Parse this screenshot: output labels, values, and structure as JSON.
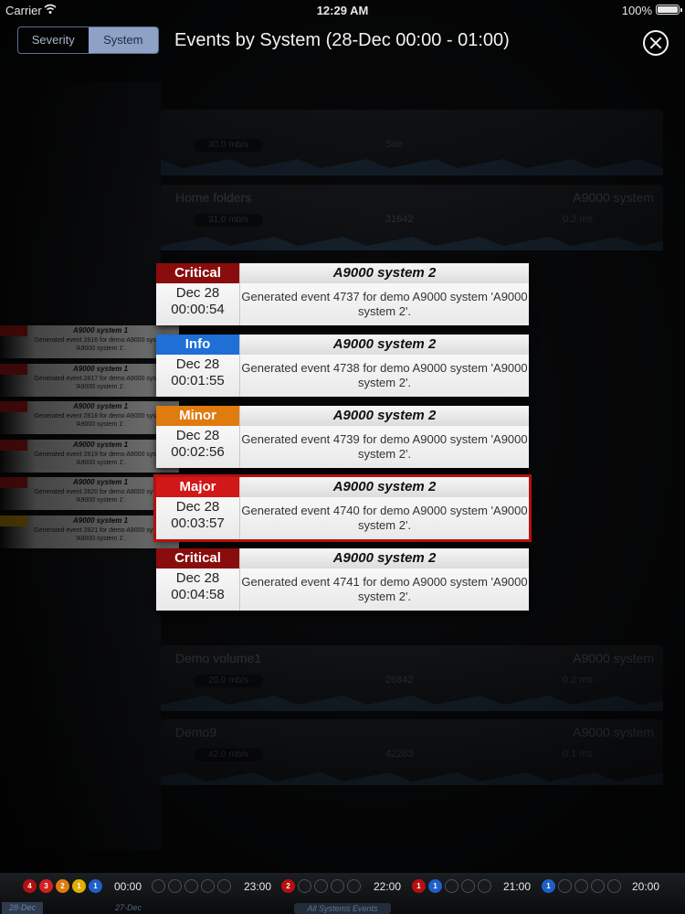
{
  "status_bar": {
    "carrier": "Carrier",
    "time": "12:29 AM",
    "battery": "100%"
  },
  "header": {
    "tabs": [
      {
        "label": "Severity",
        "active": false
      },
      {
        "label": "System",
        "active": true
      }
    ],
    "title": "Events by System (28-Dec 00:00 - 01:00)"
  },
  "background": {
    "panels": [
      {
        "name": "",
        "system": "",
        "pill": "30.0 mb/s",
        "mid": "Sim",
        "right": ""
      },
      {
        "name": "Home folders",
        "system": "A9000 system",
        "pill": "31.0 mb/s",
        "mid": "31642",
        "right": "0.2 ms"
      },
      {
        "name": "Demo volume1",
        "system": "A9000 system",
        "pill": "20.0 mb/s",
        "mid": "26842",
        "right": "0.2 ms"
      },
      {
        "name": "Demo9",
        "system": "A9000 system",
        "pill": "42.0 mb/s",
        "mid": "42263",
        "right": "0.1 ms"
      }
    ],
    "stack_events": [
      {
        "title": "A9000 system 1",
        "desc": "Generated event 2816 for demo A9000 system 'A9000 system 1'.",
        "color": "#c01818"
      },
      {
        "title": "A9000 system 1",
        "desc": "Generated event 2817 for demo A9000 system 'A9000 system 1'.",
        "color": "#c01818"
      },
      {
        "title": "A9000 system 1",
        "desc": "Generated event 2818 for demo A9000 system 'A9000 system 1'.",
        "color": "#c01818"
      },
      {
        "title": "A9000 system 1",
        "desc": "Generated event 2819 for demo A9000 system 'A9000 system 1'.",
        "color": "#c01818"
      },
      {
        "title": "A9000 system 1",
        "desc": "Generated event 2820 for demo A9000 system 'A9000 system 1'.",
        "color": "#c01818"
      },
      {
        "title": "A9000 system 1",
        "desc": "Generated event 2821 for demo A9000 system 'A9000 system 1'.",
        "color": "#e0a800"
      }
    ]
  },
  "events": [
    {
      "severity": "Critical",
      "color": "#8a0d0d",
      "date": "Dec 28",
      "time": "00:00:54",
      "system": "A9000 system 2",
      "description": "Generated event 4737 for demo A9000 system 'A9000 system 2'.",
      "selected": false
    },
    {
      "severity": "Info",
      "color": "#1f6fd6",
      "date": "Dec 28",
      "time": "00:01:55",
      "system": "A9000 system 2",
      "description": "Generated event 4738 for demo A9000 system 'A9000 system 2'.",
      "selected": false
    },
    {
      "severity": "Minor",
      "color": "#e07b10",
      "date": "Dec 28",
      "time": "00:02:56",
      "system": "A9000 system 2",
      "description": "Generated event 4739 for demo A9000 system 'A9000 system 2'.",
      "selected": false
    },
    {
      "severity": "Major",
      "color": "#d01818",
      "date": "Dec 28",
      "time": "00:03:57",
      "system": "A9000 system 2",
      "description": "Generated event 4740 for demo A9000 system 'A9000 system 2'.",
      "selected": true
    },
    {
      "severity": "Critical",
      "color": "#8a0d0d",
      "date": "Dec 28",
      "time": "00:04:58",
      "system": "A9000 system 2",
      "description": "Generated event 4741 for demo A9000 system 'A9000 system 2'.",
      "selected": false
    }
  ],
  "timeline": {
    "hours": [
      {
        "time": "00:00",
        "counts": [
          {
            "n": "4",
            "color": "#b51010"
          },
          {
            "n": "3",
            "color": "#d32020"
          },
          {
            "n": "2",
            "color": "#e07b10"
          },
          {
            "n": "1",
            "color": "#e0b000"
          },
          {
            "n": "1",
            "color": "#1f5fc8"
          }
        ]
      },
      {
        "time": "23:00",
        "counts": []
      },
      {
        "time": "22:00",
        "counts": [
          {
            "n": "2",
            "color": "#b51010"
          }
        ]
      },
      {
        "time": "21:00",
        "counts": [
          {
            "n": "1",
            "color": "#b51010"
          },
          {
            "n": "1",
            "color": "#1f5fc8"
          }
        ]
      },
      {
        "time": "20:00",
        "counts": [
          {
            "n": "1",
            "color": "#1f5fc8"
          }
        ]
      }
    ],
    "date_tabs": [
      "28-Dec",
      "27-Dec"
    ],
    "all_systems": "All Systems Events"
  }
}
